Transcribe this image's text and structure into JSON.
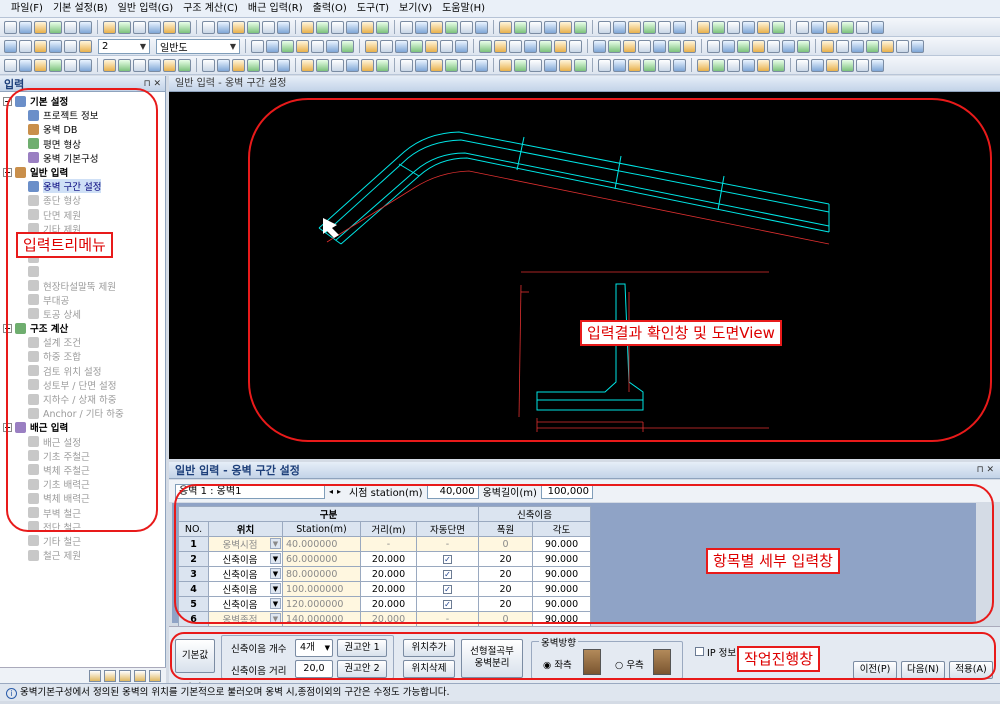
{
  "menu": [
    "파일(F)",
    "기본 설정(B)",
    "일반 입력(G)",
    "구조 계산(C)",
    "배근 입력(R)",
    "출력(O)",
    "도구(T)",
    "보기(V)",
    "도움말(H)"
  ],
  "toolbar": {
    "combo_num": "2",
    "combo_view": "일반도"
  },
  "left_panel": {
    "title": "입력",
    "pins": "⊓ ✕",
    "groups": [
      {
        "label": "기본 설정",
        "items": [
          {
            "label": "프로젝트 정보",
            "enabled": true
          },
          {
            "label": "옹벽 DB",
            "enabled": true
          },
          {
            "label": "평면 형상",
            "enabled": true
          },
          {
            "label": "옹벽 기본구성",
            "enabled": true
          }
        ]
      },
      {
        "label": "일반 입력",
        "items": [
          {
            "label": "옹벽 구간 설정",
            "enabled": true,
            "selected": true
          },
          {
            "label": "종단 형상",
            "enabled": false
          },
          {
            "label": "단면 제원",
            "enabled": false
          },
          {
            "label": "기타 제원",
            "enabled": false
          },
          {
            "label": "",
            "enabled": false
          },
          {
            "label": "",
            "enabled": false
          },
          {
            "label": "",
            "enabled": false
          },
          {
            "label": "현장타설말뚝 제원",
            "enabled": false
          },
          {
            "label": "부대공",
            "enabled": false
          },
          {
            "label": "토공 상세",
            "enabled": false
          }
        ]
      },
      {
        "label": "구조 계산",
        "items": [
          {
            "label": "설계 조건",
            "enabled": false
          },
          {
            "label": "하중 조합",
            "enabled": false
          },
          {
            "label": "검토 위치 설정",
            "enabled": false
          },
          {
            "label": "성토부 / 단면 설정",
            "enabled": false
          },
          {
            "label": "지하수 / 상재 하중",
            "enabled": false
          },
          {
            "label": "Anchor / 기타 하중",
            "enabled": false
          }
        ]
      },
      {
        "label": "배근 입력",
        "items": [
          {
            "label": "배근 설정",
            "enabled": false
          },
          {
            "label": "기초 주철근",
            "enabled": false
          },
          {
            "label": "벽체 주철근",
            "enabled": false
          },
          {
            "label": "기초 배력근",
            "enabled": false
          },
          {
            "label": "벽체 배력근",
            "enabled": false
          },
          {
            "label": "부벽 철근",
            "enabled": false
          },
          {
            "label": "전단 철근",
            "enabled": false
          },
          {
            "label": "기타 철근",
            "enabled": false
          },
          {
            "label": "철근 제원",
            "enabled": false
          }
        ]
      }
    ]
  },
  "drawing_panel": {
    "title": "일반 입력 - 옹벽 구간 설정"
  },
  "input_panel": {
    "title": "일반 입력 - 옹벽 구간 설정",
    "pins": "⊓ ✕",
    "wall_select": "옹벽 1 : 옹벽1",
    "start_label": "시점 station(m)",
    "start_value": "40,000",
    "length_label": "옹벽길이(m)",
    "length_value": "100,000"
  },
  "table": {
    "group_header": "구분",
    "joint_header": "신축이음",
    "headers": [
      "NO.",
      "위치",
      "Station(m)",
      "거리(m)",
      "자동단면",
      "폭원",
      "각도"
    ],
    "rows": [
      {
        "no": "1",
        "pos": "옹벽시점",
        "station": "40.000000",
        "dist": "-",
        "auto": "-",
        "width": "0",
        "angle": "90.000"
      },
      {
        "no": "2",
        "pos": "신축이음",
        "station": "60.000000",
        "dist": "20.000",
        "auto": "check",
        "width": "20",
        "angle": "90.000"
      },
      {
        "no": "3",
        "pos": "신축이음",
        "station": "80.000000",
        "dist": "20.000",
        "auto": "check",
        "width": "20",
        "angle": "90.000"
      },
      {
        "no": "4",
        "pos": "신축이음",
        "station": "100.000000",
        "dist": "20.000",
        "auto": "check",
        "width": "20",
        "angle": "90.000"
      },
      {
        "no": "5",
        "pos": "신축이음",
        "station": "120.000000",
        "dist": "20.000",
        "auto": "check",
        "width": "20",
        "angle": "90.000"
      },
      {
        "no": "6",
        "pos": "옹벽종점",
        "station": "140.000000",
        "dist": "20.000",
        "auto": "-",
        "width": "0",
        "angle": "90.000"
      }
    ]
  },
  "workbar": {
    "default_btn": "기본값(D)",
    "joint_count_label": "신축이음 개수",
    "joint_count_value": "4개",
    "rec1": "권고안 1",
    "joint_dist_label": "신축이음 거리",
    "joint_dist_value": "20,0",
    "rec2": "권고안 2",
    "add_pos": "위치추가",
    "del_pos": "위치삭제",
    "split_l1": "선형절곡부",
    "split_l2": "옹벽분리",
    "direction_title": "옹벽방향",
    "left": "좌측",
    "right": "우측",
    "ip_info": "IP 정보 표",
    "prev": "이전(P)",
    "next": "다음(N)",
    "apply": "적용(A)"
  },
  "status": "옹벽기본구성에서 정의된 옹벽의 위치를 기본적으로 불러오며 옹벽 시,종점이외의 구간은 수정도 가능합니다.",
  "annotations": {
    "tree": "입력트리메뉴",
    "view": "입력결과 확인창 및 도면View",
    "detail": "항목별 세부 입력창",
    "progress": "작업진행창"
  },
  "colors": {
    "annotation": "#e81a1a",
    "drawing_line": "#00e5e5",
    "dim_line": "#e03030"
  }
}
